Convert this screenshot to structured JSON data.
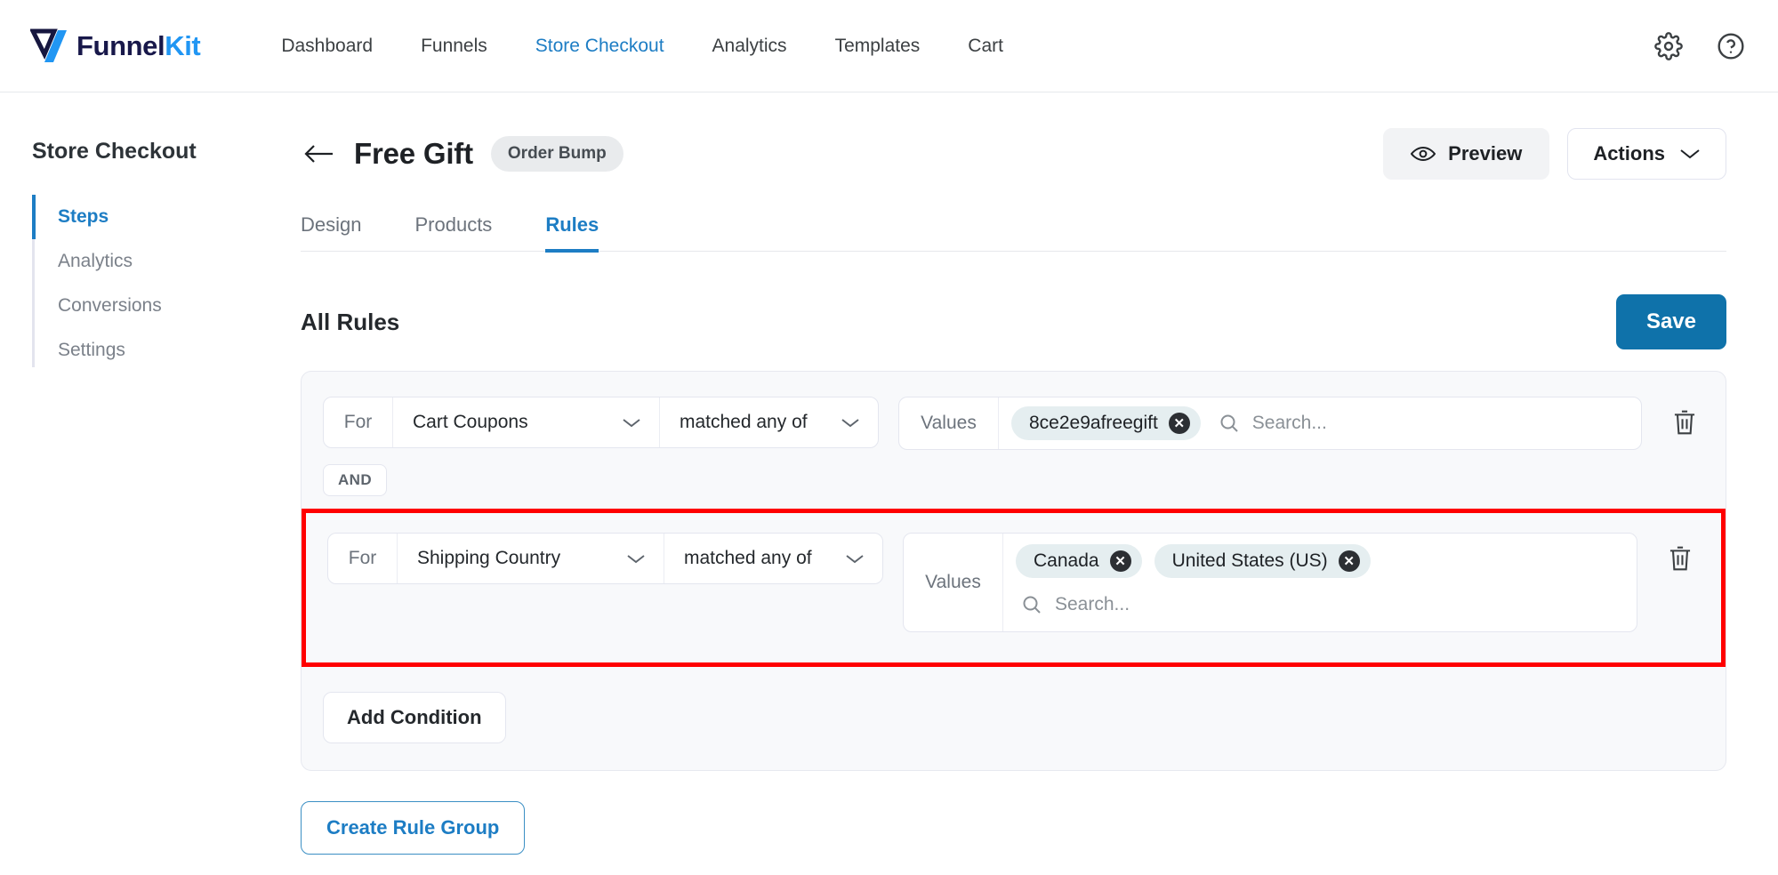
{
  "topbar": {
    "logo": {
      "name_first": "Funnel",
      "name_second": "Kit",
      "icon": "funnelkit-logo-mark"
    },
    "nav": [
      {
        "label": "Dashboard",
        "active": false
      },
      {
        "label": "Funnels",
        "active": false
      },
      {
        "label": "Store Checkout",
        "active": true
      },
      {
        "label": "Analytics",
        "active": false
      },
      {
        "label": "Templates",
        "active": false
      },
      {
        "label": "Cart",
        "active": false
      }
    ],
    "settings_icon": "gear-icon",
    "help_icon": "help-circle-icon"
  },
  "sidebar": {
    "title": "Store Checkout",
    "items": [
      {
        "label": "Steps",
        "active": true
      },
      {
        "label": "Analytics",
        "active": false
      },
      {
        "label": "Conversions",
        "active": false
      },
      {
        "label": "Settings",
        "active": false
      }
    ]
  },
  "header": {
    "back_icon": "arrow-left-icon",
    "title": "Free Gift",
    "badge": "Order Bump",
    "preview_label": "Preview",
    "preview_icon": "eye-icon",
    "actions_label": "Actions",
    "actions_icon": "chevron-down-icon"
  },
  "tabs": [
    {
      "label": "Design",
      "active": false
    },
    {
      "label": "Products",
      "active": false
    },
    {
      "label": "Rules",
      "active": true
    }
  ],
  "rules": {
    "section_title": "All Rules",
    "save_label": "Save",
    "add_condition_label": "Add Condition",
    "create_rule_group_label": "Create Rule Group",
    "and_label": "AND",
    "for_label": "For",
    "values_label": "Values",
    "search_placeholder": "Search...",
    "search_value": "",
    "delete_icon": "trash-icon",
    "search_icon": "search-icon",
    "conditions": [
      {
        "subject": "Cart Coupons",
        "operator": "matched any of",
        "chips": [
          "8ce2e9afreegift"
        ],
        "highlighted": false
      },
      {
        "subject": "Shipping Country",
        "operator": "matched any of",
        "chips": [
          "Canada",
          "United States (US)"
        ],
        "highlighted": true
      }
    ]
  },
  "colors": {
    "brand_blue": "#1d7dc4",
    "save_blue": "#0f72aa",
    "logo_accent": "#2196f3",
    "highlight_red": "#ff0000",
    "chip_bg": "#e5eef0"
  }
}
